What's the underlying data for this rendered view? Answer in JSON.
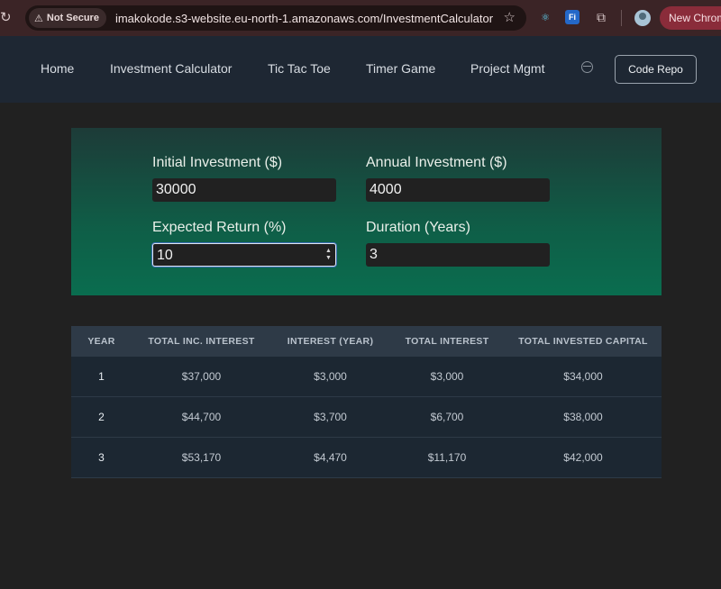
{
  "browser": {
    "security_label": "Not Secure",
    "url": "imakokode.s3-website.eu-north-1.amazonaws.com/InvestmentCalculator",
    "new_chrome_label": "New Chrom",
    "extensions": [
      "react-devtools-icon",
      "fi-extension-icon",
      "puzzle-icon"
    ]
  },
  "nav": {
    "items": [
      "Home",
      "Investment Calculator",
      "Tic Tac Toe",
      "Timer Game",
      "Project Mgmt"
    ],
    "code_repo_label": "Code Repo"
  },
  "inputs": {
    "initial_investment": {
      "label": "Initial Investment ($)",
      "value": "30000"
    },
    "annual_investment": {
      "label": "Annual Investment ($)",
      "value": "4000"
    },
    "expected_return": {
      "label": "Expected Return (%)",
      "value": "10"
    },
    "duration": {
      "label": "Duration (Years)",
      "value": "3"
    }
  },
  "table": {
    "headers": [
      "YEAR",
      "TOTAL INC. INTEREST",
      "INTEREST (YEAR)",
      "TOTAL INTEREST",
      "TOTAL INVESTED CAPITAL"
    ],
    "rows": [
      [
        "1",
        "$37,000",
        "$3,000",
        "$3,000",
        "$34,000"
      ],
      [
        "2",
        "$44,700",
        "$3,700",
        "$6,700",
        "$38,000"
      ],
      [
        "3",
        "$53,170",
        "$4,470",
        "$11,170",
        "$42,000"
      ]
    ]
  },
  "colors": {
    "panel_top": "#1d3b38",
    "panel_bottom": "#0a6d4f",
    "nav_bg": "#1e2733",
    "table_header_bg": "#2e3a47",
    "table_row_bg": "#1c2732"
  }
}
